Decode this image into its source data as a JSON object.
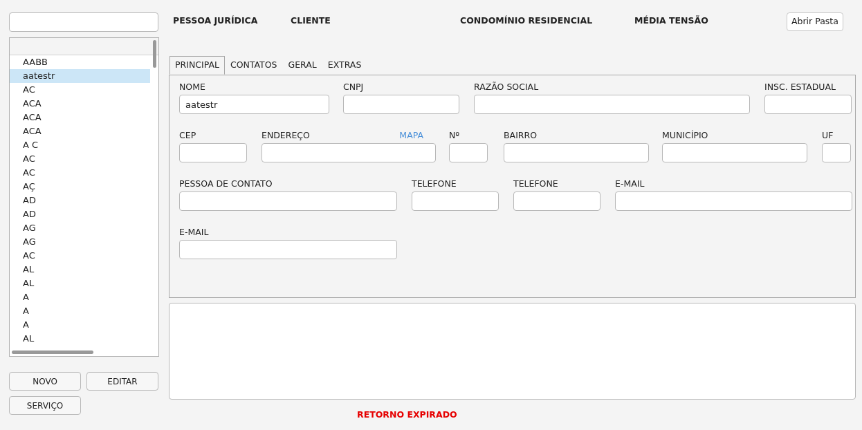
{
  "client_list": [
    {
      "name": "AABB",
      "selected": false
    },
    {
      "name": "aatestr",
      "selected": true
    },
    {
      "name": "AC",
      "selected": false
    },
    {
      "name": "ACA",
      "selected": false
    },
    {
      "name": "ACA",
      "selected": false
    },
    {
      "name": "ACA",
      "selected": false
    },
    {
      "name": "A C",
      "selected": false
    },
    {
      "name": "AC",
      "selected": false
    },
    {
      "name": "AC",
      "selected": false
    },
    {
      "name": "AÇ",
      "selected": false
    },
    {
      "name": "AD",
      "selected": false
    },
    {
      "name": "AD",
      "selected": false
    },
    {
      "name": "AG",
      "selected": false
    },
    {
      "name": "AG",
      "selected": false
    },
    {
      "name": "AC",
      "selected": false
    },
    {
      "name": "AL",
      "selected": false
    },
    {
      "name": "AL",
      "selected": false
    },
    {
      "name": "A",
      "selected": false
    },
    {
      "name": "A",
      "selected": false
    },
    {
      "name": "A",
      "selected": false
    },
    {
      "name": "AL",
      "selected": false
    }
  ],
  "list_buttons": [
    "NOVO",
    "EDITAR",
    "SERVIÇO"
  ],
  "header": {
    "tags": [
      "PESSOA JURÍDICA",
      "CLIENTE",
      "CONDOMÍNIO RESIDENCIAL",
      "MÉDIA TENSÃO"
    ],
    "button": "Abrir Pasta"
  },
  "tabs": [
    {
      "label": "PRINCIPAL",
      "selected": true
    },
    {
      "label": "CONTATOS",
      "selected": false
    },
    {
      "label": "GERAL",
      "selected": false
    },
    {
      "label": "EXTRAS",
      "selected": false
    }
  ],
  "form_rows": [
    [
      {
        "label": "NOME",
        "value": "aatestr"
      },
      {
        "label": "CNPJ"
      },
      {
        "label": "RAZÃO SOCIAL"
      },
      {
        "label": "INSC. ESTADUAL"
      }
    ],
    [
      {
        "label": "CEP"
      },
      {
        "label": "ENDEREÇO",
        "link": "MAPA"
      },
      {
        "label": "Nº"
      },
      {
        "label": "BAIRRO"
      },
      {
        "label": "MUNICÍPIO"
      },
      {
        "label": "UF"
      }
    ],
    [
      {
        "label": "PESSOA DE CONTATO"
      },
      {
        "label": "TELEFONE"
      },
      {
        "label": "TELEFONE"
      },
      {
        "label": "E-MAIL"
      }
    ],
    [
      {
        "label": "E-MAIL"
      }
    ]
  ],
  "status": "RETORNO EXPIRADO"
}
